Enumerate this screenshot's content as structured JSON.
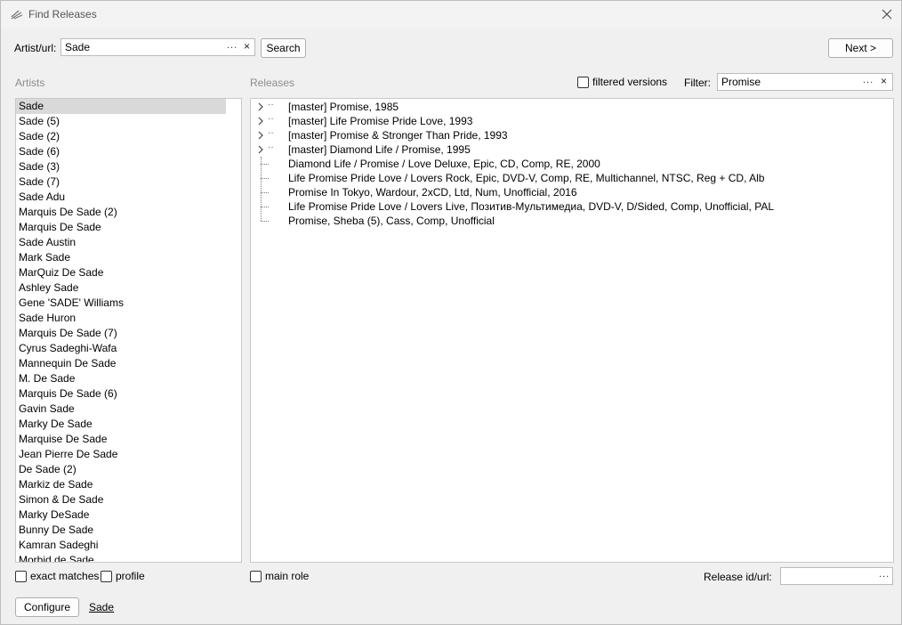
{
  "window": {
    "title": "Find Releases"
  },
  "search": {
    "artist_label": "Artist/url:",
    "artist_value": "Sade",
    "dots": "...",
    "clear": "×",
    "search_button": "Search",
    "next_button": "Next >"
  },
  "artists": {
    "header": "Artists",
    "items": [
      "Sade",
      "Sade (5)",
      "Sade (2)",
      "Sade (6)",
      "Sade (3)",
      "Sade (7)",
      "Sade Adu",
      "Marquis De Sade (2)",
      "Marquis De Sade",
      "Sade Austin",
      "Mark Sade",
      "MarQuiz De Sade",
      "Ashley Sade",
      "Gene 'SADE' Williams",
      "Sade Huron",
      "Marquis De Sade (7)",
      "Cyrus Sadeghi-Wafa",
      "Mannequin De Sade",
      "M. De Sade",
      "Marquis De Sade (6)",
      "Gavin Sade",
      "Marky De Sade",
      "Marquise De Sade",
      "Jean Pierre De Sade",
      "De Sade (2)",
      "Markiz de Sade",
      "Simon & De Sade",
      "Marky DeSade",
      "Bunny De Sade",
      "Kamran Sadeghi",
      "Morbid de Sade"
    ],
    "selected_index": 0
  },
  "releases": {
    "header": "Releases",
    "filtered_versions_label": "filtered versions",
    "filter_label": "Filter:",
    "filter_value": "Promise",
    "masters": [
      "[master] Promise, 1985",
      "[master] Life Promise Pride Love, 1993",
      "[master] Promise & Stronger Than Pride, 1993",
      "[master] Diamond Life / Promise, 1995"
    ],
    "items": [
      "Diamond Life / Promise / Love Deluxe, Epic, CD, Comp, RE, 2000",
      "Life Promise Pride Love / Lovers Rock, Epic, DVD-V, Comp, RE, Multichannel, NTSC, Reg + CD, Alb",
      "Promise In Tokyo, Wardour, 2xCD, Ltd, Num, Unofficial, 2016",
      "Life Promise Pride Love / Lovers Live, Позитив-Мультимедиа, DVD-V, D/Sided, Comp, Unofficial, PAL",
      "Promise, Sheba (5), Cass, Comp, Unofficial"
    ]
  },
  "bottom": {
    "exact_matches_label": "exact matches",
    "profile_label": "profile",
    "main_role_label": "main role",
    "release_id_label": "Release id/url:",
    "release_id_value": "",
    "configure_button": "Configure",
    "artist_link": "Sade"
  },
  "icons": {
    "app": "list-lines-icon",
    "close": "close-icon",
    "expand": "chevron-right-icon"
  }
}
